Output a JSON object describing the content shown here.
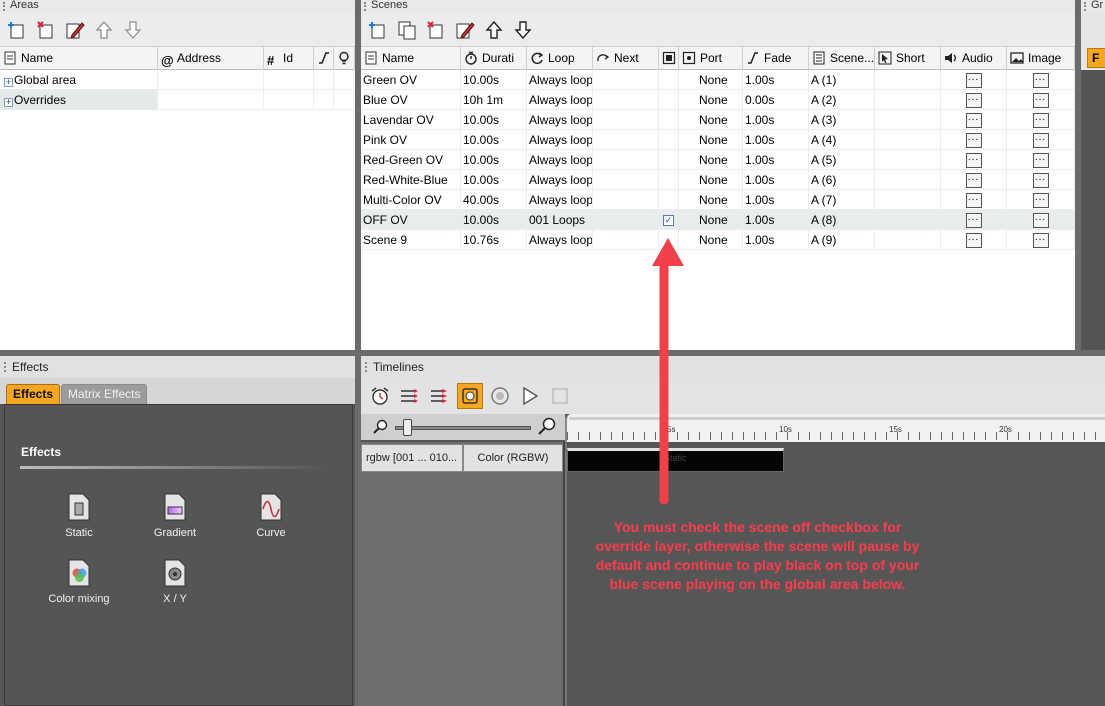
{
  "areas": {
    "title": "Areas",
    "columns": [
      "Name",
      "Address",
      "Id"
    ],
    "rows": [
      "Global area",
      "Overrides"
    ]
  },
  "scenes": {
    "title": "Scenes",
    "columns": [
      "Name",
      "Durati",
      "Loop",
      "Next",
      "Port",
      "Fade",
      "Scene...",
      "Short",
      "Audio",
      "Image"
    ],
    "rows": [
      {
        "name": "Green OV",
        "duration": "10.00s",
        "loop": "Always loop",
        "off": false,
        "port": "None",
        "fade": "1.00s",
        "scene": "A (1)"
      },
      {
        "name": "Blue OV",
        "duration": "10h 1m",
        "loop": "Always loop",
        "off": false,
        "port": "None",
        "fade": "0.00s",
        "scene": "A (2)"
      },
      {
        "name": "Lavendar OV",
        "duration": "10.00s",
        "loop": "Always loop",
        "off": false,
        "port": "None",
        "fade": "1.00s",
        "scene": "A (3)"
      },
      {
        "name": "Pink OV",
        "duration": "10.00s",
        "loop": "Always loop",
        "off": false,
        "port": "None",
        "fade": "1.00s",
        "scene": "A (4)"
      },
      {
        "name": "Red-Green OV",
        "duration": "10.00s",
        "loop": "Always loop",
        "off": false,
        "port": "None",
        "fade": "1.00s",
        "scene": "A (5)"
      },
      {
        "name": "Red-White-Blue",
        "duration": "10.00s",
        "loop": "Always loop",
        "off": false,
        "port": "None",
        "fade": "1.00s",
        "scene": "A (6)"
      },
      {
        "name": "Multi-Color OV",
        "duration": "40.00s",
        "loop": "Always loop",
        "off": false,
        "port": "None",
        "fade": "1.00s",
        "scene": "A (7)"
      },
      {
        "name": "OFF OV",
        "duration": "10.00s",
        "loop": "001 Loops",
        "off": true,
        "port": "None",
        "fade": "1.00s",
        "scene": "A (8)"
      },
      {
        "name": "Scene 9",
        "duration": "10.76s",
        "loop": "Always loop",
        "off": false,
        "port": "None",
        "fade": "1.00s",
        "scene": "A (9)"
      }
    ],
    "dots_label": "...",
    "check_mark": "✓"
  },
  "right_panel": {
    "title": "Gr",
    "tab": "F"
  },
  "effects": {
    "title": "Effects",
    "tabs": [
      "Effects",
      "Matrix Effects"
    ],
    "section": "Effects",
    "items": [
      {
        "label": "Static",
        "icon": "static-effect-icon"
      },
      {
        "label": "Gradient",
        "icon": "gradient-effect-icon"
      },
      {
        "label": "Curve",
        "icon": "curve-effect-icon"
      },
      {
        "label": "Color mixing",
        "icon": "color-mixing-effect-icon"
      },
      {
        "label": "X / Y",
        "icon": "xy-effect-icon"
      }
    ]
  },
  "timelines": {
    "title": "Timelines",
    "track_name": "rgbw [001 ... 010...",
    "track_type": "Color (RGBW)",
    "ruler_ticks": [
      "5s",
      "10s",
      "15s",
      "20s"
    ],
    "clip_label": "Static"
  },
  "annotation": {
    "text": "You must check the scene off checkbox for override layer, otherwise the scene will pause by default and continue to play black on top of your blue scene playing on the global area below.",
    "color": "#ff3b4b"
  },
  "colors": {
    "accent": "#f5a623",
    "arrow": "#f0414b"
  }
}
